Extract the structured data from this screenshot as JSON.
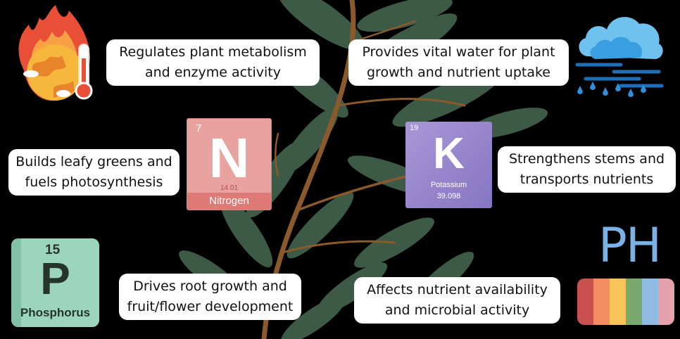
{
  "cards": {
    "metabolism": [
      "Regulates plant metabolism",
      "and enzyme activity"
    ],
    "water": [
      "Provides vital water for plant",
      "growth and nutrient uptake"
    ],
    "nitrogen": [
      "Builds leafy greens and",
      "fuels photosynthesis"
    ],
    "potassium": [
      "Strengthens stems and",
      "transports nutrients"
    ],
    "phosphorus": [
      "Drives root growth and",
      "fruit/flower development"
    ],
    "ph": [
      "Affects nutrient availability",
      "and microbial activity"
    ]
  },
  "elements": {
    "nitrogen": {
      "number": "7",
      "symbol": "N",
      "mass": "14.01",
      "name": "Nitrogen"
    },
    "potassium": {
      "number": "19",
      "symbol": "K",
      "name": "Potassium",
      "mass": "39.098"
    },
    "phosphorus": {
      "number": "15",
      "symbol": "P",
      "name": "Phosphorus"
    }
  },
  "ph": {
    "label": "PH",
    "colors": [
      "#c8504f",
      "#f38c5e",
      "#f8c45a",
      "#79a96d",
      "#8fbbe3",
      "#e6a2ac"
    ]
  },
  "icons": {
    "temperature": "globe-fire-thermometer-icon",
    "weather": "rain-cloud-wind-icon"
  },
  "colors": {
    "background": "#000000",
    "leaf": "#3d5a46",
    "stem": "#8a5a2c"
  }
}
